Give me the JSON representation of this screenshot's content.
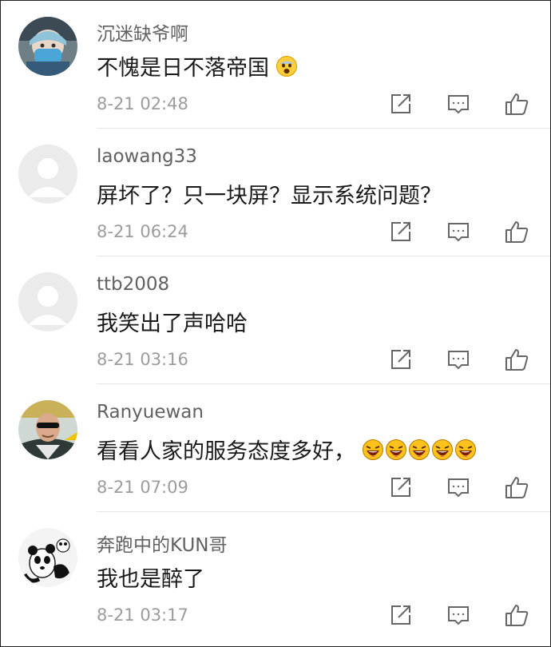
{
  "comments": [
    {
      "username": "沉迷缺爷啊",
      "text": "不愧是日不落帝国",
      "emoji": [
        "fearful-face-emoji"
      ],
      "time": "8-21 02:48",
      "avatar": "anime-character-avatar"
    },
    {
      "username": "laowang33",
      "text": "屏坏了？只一块屏？显示系统问题？",
      "emoji": [],
      "time": "8-21 06:24",
      "avatar": "default-user-avatar"
    },
    {
      "username": "ttb2008",
      "text": "我笑出了声哈哈",
      "emoji": [],
      "time": "8-21 03:16",
      "avatar": "default-user-avatar"
    },
    {
      "username": "Ranyuewan",
      "text": "看看人家的服务态度多好，",
      "emoji": [
        "laughing-face-emoji",
        "laughing-face-emoji",
        "laughing-face-emoji",
        "laughing-face-emoji",
        "laughing-face-emoji"
      ],
      "time": "8-21 07:09",
      "avatar": "man-with-sunglasses-avatar"
    },
    {
      "username": "奔跑中的KUN哥",
      "text": "我也是醉了",
      "emoji": [],
      "time": "8-21 03:17",
      "avatar": "panda-avatar"
    }
  ],
  "actions": {
    "share_icon": "share-icon",
    "reply_icon": "comment-icon",
    "like_icon": "thumbs-up-icon"
  },
  "colors": {
    "username": "#616161",
    "text": "#1a1a1a",
    "time": "#9c9c9c",
    "icon": "#666666",
    "divider": "#e5e5e5"
  }
}
